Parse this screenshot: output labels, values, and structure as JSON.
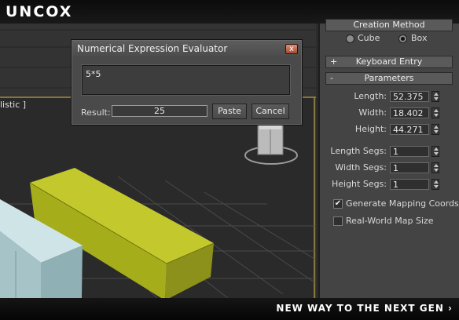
{
  "brand": {
    "logo_text": "UNCOX"
  },
  "footer": {
    "tagline": "NEW WAY TO THE NEXT GEN ›"
  },
  "viewport": {
    "label": "listic ]"
  },
  "creation_method": {
    "title": "Creation Method",
    "options": [
      "Cube",
      "Box"
    ],
    "selected": "Box"
  },
  "keyboard_entry": {
    "sign": "+",
    "title": "Keyboard Entry"
  },
  "parameters": {
    "sign": "-",
    "title": "Parameters",
    "fields": [
      {
        "label": "Length:",
        "value": "52.375"
      },
      {
        "label": "Width:",
        "value": "18.402"
      },
      {
        "label": "Height:",
        "value": "44.271"
      }
    ],
    "segs": [
      {
        "label": "Length Segs:",
        "value": "1"
      },
      {
        "label": "Width Segs:",
        "value": "1"
      },
      {
        "label": "Height Segs:",
        "value": "1"
      }
    ],
    "checkboxes": [
      {
        "label": "Generate Mapping Coords.",
        "checked": true,
        "mark": "✔"
      },
      {
        "label": "Real-World Map Size",
        "checked": false,
        "mark": ""
      }
    ]
  },
  "dialog": {
    "title": "Numerical Expression Evaluator",
    "close_glyph": "x",
    "expression": "5*5",
    "result_label": "Result:",
    "result_value": "25",
    "paste_label": "Paste",
    "cancel_label": "Cancel"
  },
  "colors": {
    "box_lime_front": "#a5ad1b",
    "box_lime_top": "#c3c92d",
    "box_cyan_front": "#a6c4c8",
    "box_cyan_top": "#cfe4e6"
  },
  "icons": {
    "close": "close-icon",
    "radio": "radio-icon",
    "spinner": "spinner-icon",
    "checkbox": "checkmark-icon"
  }
}
